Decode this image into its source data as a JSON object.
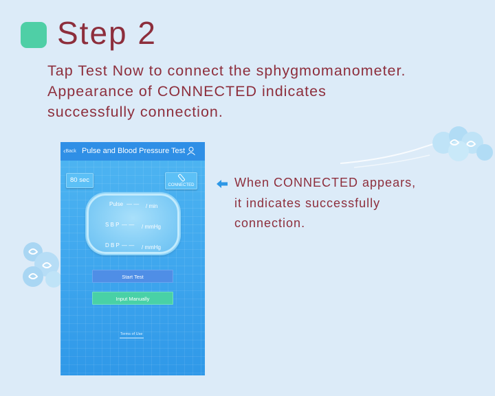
{
  "step": {
    "title": "Step 2",
    "badge_color": "#4fcfa6",
    "text_color": "#8d2e3c"
  },
  "intro": {
    "lines": [
      "Tap Test Now to connect the sphygmomanometer.",
      "Appearance of  CONNECTED indicates",
      "successfully connection."
    ]
  },
  "phone": {
    "header": {
      "back_label": "Back",
      "back_icon": "chevron-left-icon",
      "title": "Pulse and Blood Pressure Test",
      "user_icon": "user-icon"
    },
    "timer_label": "80 sec",
    "connection": {
      "icon": "bluetooth-link-icon",
      "label": "CONNECTED"
    },
    "metrics": [
      {
        "label": "Pulse",
        "value": "— —",
        "unit": "/ min"
      },
      {
        "label": "S B P",
        "value": "— —",
        "unit": "/ mmHg"
      },
      {
        "label": "D B P",
        "value": "— —",
        "unit": "/ mmHg"
      }
    ],
    "buttons": {
      "start": "Start Test",
      "manual": "Input Manually"
    },
    "terms_label": "Terms of Use",
    "colors": {
      "header": "#2f8fe6",
      "start_button": "#4f8ee6",
      "manual_button": "#49d1a6"
    }
  },
  "note": {
    "arrow_icon": "arrow-left-icon",
    "lines": [
      "When CONNECTED appears,",
      "it indicates successfully",
      "connection."
    ]
  }
}
